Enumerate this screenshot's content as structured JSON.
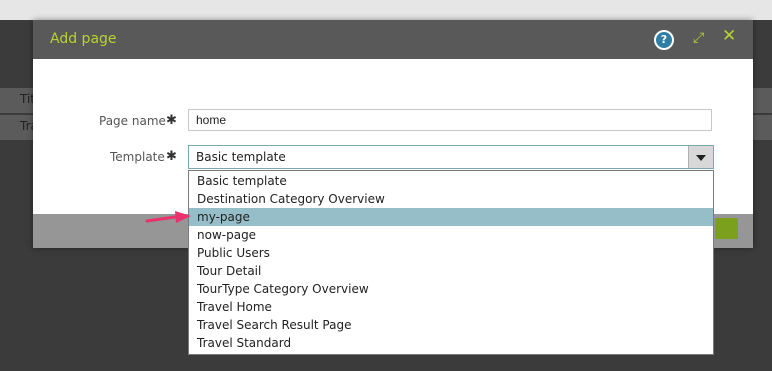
{
  "background": {
    "rows": [
      {
        "text": "Titl"
      },
      {
        "text": "Tra"
      }
    ]
  },
  "dialog": {
    "title": "Add page",
    "icons": [
      "help-icon",
      "expand-icon",
      "close-icon"
    ],
    "help_glyph": "?",
    "close_glyph": "✕",
    "expand_glyph": "⤢"
  },
  "form": {
    "page_name_label": "Page name",
    "page_name_value": "home",
    "template_label": "Template",
    "template_value": "Basic template",
    "required_mark": "✱"
  },
  "dropdown": {
    "options": [
      "Basic template",
      "Destination Category Overview",
      "my-page",
      "now-page",
      "Public Users",
      "Tour Detail",
      "TourType Category Overview",
      "Travel Home",
      "Travel Search Result Page",
      "Travel Standard"
    ],
    "highlighted_index": 2
  },
  "colors": {
    "accent": "#b6d330",
    "header": "#595959",
    "highlight": "#95bec9",
    "arrow": "#e8336d",
    "primary_button": "#7aa01e"
  }
}
